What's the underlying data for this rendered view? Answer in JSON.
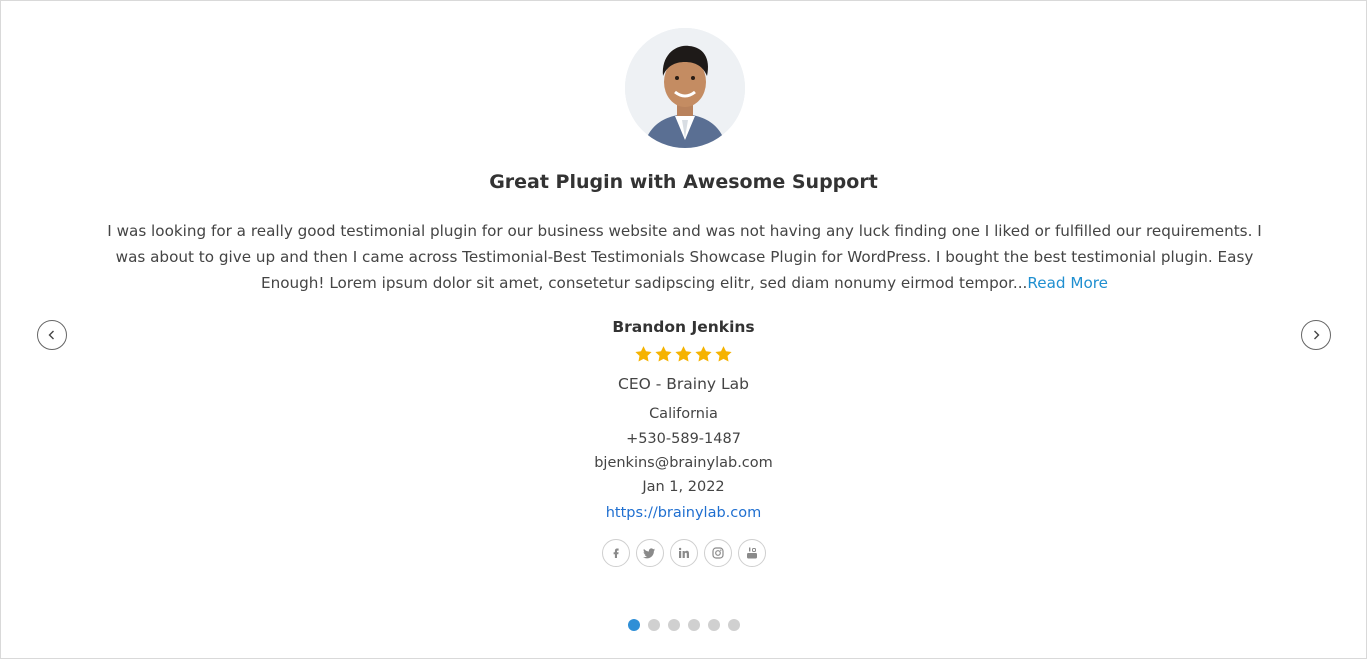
{
  "testimonial": {
    "title": "Great Plugin with Awesome Support",
    "content": "I was looking for a really good testimonial plugin for our business website and was not having any luck finding one I liked or fulfilled our requirements. I was about to give up and then I came across Testimonial-Best Testimonials Showcase Plugin for WordPress. I bought the best testimonial plugin. Easy Enough! Lorem ipsum dolor sit amet, consetetur sadipscing elitr, sed diam nonumy eirmod tempor...",
    "read_more_label": "Read More",
    "reviewer_name": "Brandon Jenkins",
    "rating": 5,
    "rating_max": 5,
    "designation": "CEO - Brainy Lab",
    "location": "California",
    "phone": "+530-589-1487",
    "email": "bjenkins@brainylab.com",
    "date": "Jan 1, 2022",
    "website": "https://brainylab.com"
  },
  "social_icons": [
    "facebook-icon",
    "twitter-icon",
    "linkedin-icon",
    "instagram-icon",
    "youtube-icon"
  ],
  "navigation": {
    "prev_icon": "chevron-left-icon",
    "next_icon": "chevron-right-icon"
  },
  "pagination": {
    "total": 6,
    "active": 1
  },
  "colors": {
    "accent": "#2f8fd6",
    "link": "#1f6fd0",
    "star": "#f5b301",
    "dot_inactive": "#d0d0d0"
  }
}
